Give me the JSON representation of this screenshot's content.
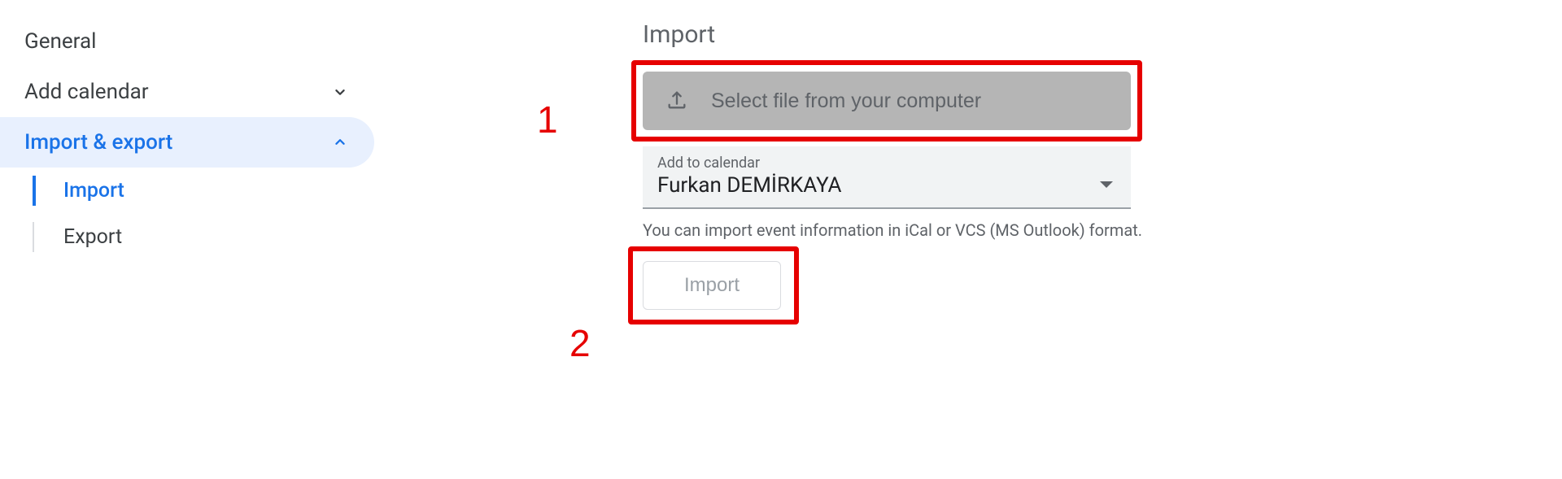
{
  "sidebar": {
    "general": "General",
    "add_calendar": "Add calendar",
    "import_export": "Import & export",
    "sub": {
      "import": "Import",
      "export": "Export"
    }
  },
  "main": {
    "title": "Import",
    "file_select_label": "Select file from your computer",
    "calendar_field_label": "Add to calendar",
    "calendar_value": "Furkan DEMİRKAYA",
    "hint": "You can import event information in iCal or VCS (MS Outlook) format.",
    "import_btn": "Import"
  },
  "annotations": {
    "one": "1",
    "two": "2"
  }
}
